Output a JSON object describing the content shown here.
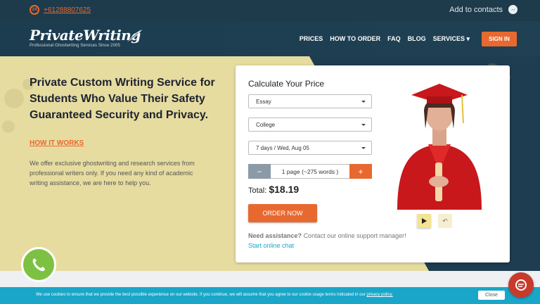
{
  "topbar": {
    "phone": "+61288807625",
    "contacts": "Add to contacts",
    "phone_badge": "24"
  },
  "logo": {
    "name": "PrivateWriting",
    "tagline": "Professional Ghostwriting Services Since 2005"
  },
  "nav": {
    "items": [
      "PRICES",
      "HOW TO ORDER",
      "FAQ",
      "BLOG",
      "SERVICES"
    ],
    "signin": "SIGN IN"
  },
  "hero": {
    "title": "Private Custom Writing Service for Students Who Value Their Safety Guaranteed Security and Privacy.",
    "how_link": "HOW IT WORKS",
    "description": "We offer exclusive ghostwriting and research services from professional writers only. If you need any kind of academic writing assistance, we are here to help you."
  },
  "calculator": {
    "title": "Calculate Your Price",
    "type": "Essay",
    "level": "College",
    "deadline": "7 days / Wed, Aug 05",
    "pages": "1 page (~275 words )",
    "minus": "−",
    "plus": "+",
    "total_label": "Total:",
    "total_value": "$18.19",
    "order_button": "ORDER NOW",
    "assist_bold": "Need assistance?",
    "assist_text": "Contact our online support manager!",
    "chat_link": "Start online chat"
  },
  "cookie": {
    "text": "We use cookies to ensure that we provide the best possible experience on our website. If you continue, we will assume that you agree to our cookie usage terms indicated in our",
    "link": "privacy policy.",
    "close": "Close"
  },
  "colors": {
    "accent": "#e8692f",
    "navy": "#1e3b4c",
    "hero_bg": "#e6dca0",
    "link": "#1aa6c8",
    "call": "#7dc142"
  }
}
